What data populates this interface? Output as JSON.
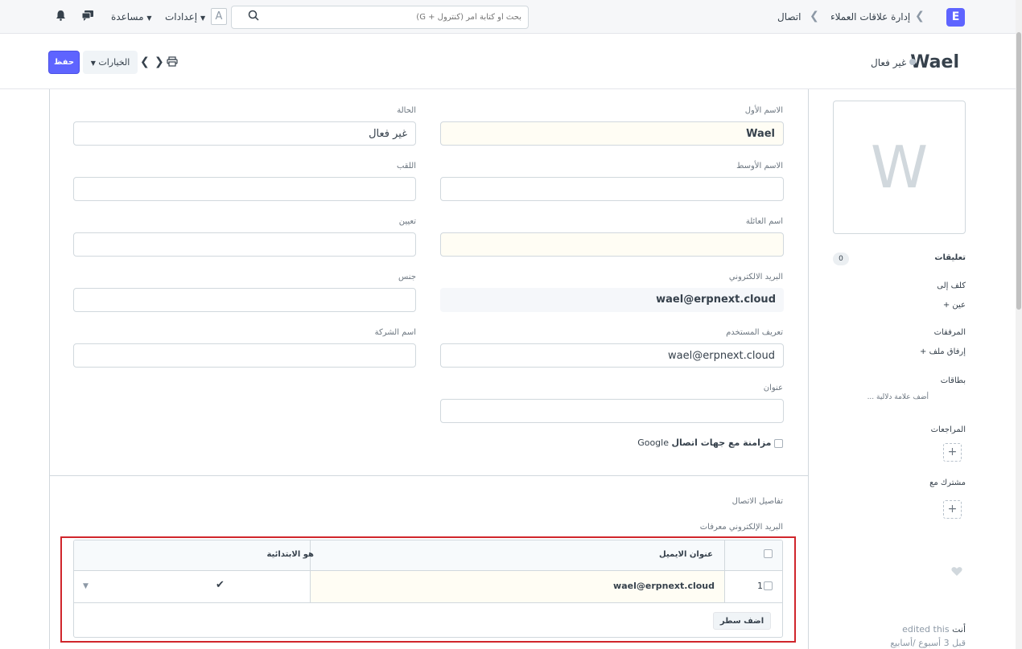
{
  "navbar": {
    "logo": "E",
    "breadcrumbs": [
      "إدارة علاقات العملاء",
      "اتصال"
    ],
    "search_placeholder": "بحث أو كتابة أمر (كنترول + G)",
    "avatar_letter": "A",
    "settings_label": "إعدادات",
    "help_label": "مساعدة",
    "chat_icon": "chat-icon",
    "bell_icon": "bell-icon"
  },
  "header": {
    "title": "Wael",
    "status": "غير فعال",
    "save_label": "حفظ",
    "options_label": "الخيارات"
  },
  "form": {
    "first_name": {
      "label": "الاسم الأول",
      "value": "Wael"
    },
    "status": {
      "label": "الحالة",
      "value": "غير فعال"
    },
    "middle_name": {
      "label": "الاسم الأوسط",
      "value": ""
    },
    "salutation": {
      "label": "اللقب",
      "value": ""
    },
    "last_name": {
      "label": "اسم العائلة",
      "value": ""
    },
    "designation": {
      "label": "تعيين",
      "value": ""
    },
    "email": {
      "label": "البريد الالكتروني",
      "value": "wael@erpnext.cloud"
    },
    "gender": {
      "label": "جنس",
      "value": ""
    },
    "user_id": {
      "label": "تعريف المستخدم",
      "value": "wael@erpnext.cloud"
    },
    "company_name": {
      "label": "اسم الشركة",
      "value": ""
    },
    "address": {
      "label": "عنوان",
      "value": ""
    },
    "google_sync": {
      "label_bold": "مزامنة مع جهات اتصال",
      "label_rest": "Google"
    }
  },
  "contact_details": {
    "section_label": "تفاصيل الاتصال",
    "emails_label": "البريد الإلكتروني معرفات",
    "columns": {
      "email": "عنوان الايميل",
      "is_primary": "هو الابتدائية"
    },
    "rows": [
      {
        "idx": "1",
        "email": "wael@erpnext.cloud",
        "is_primary": "✔"
      }
    ],
    "add_row_label": "اضف سطر"
  },
  "sidebar": {
    "avatar_letter": "W",
    "comments_label": "تعليقات",
    "comments_count": "0",
    "assigned_to_label": "كلف إلى",
    "assign_label": "عين",
    "attachments_label": "المرفقات",
    "attach_label": "إرفاق ملف",
    "tags_label": "بطاقات",
    "add_tag_label": "أضف علامة دلالية ...",
    "reviews_label": "المراجعات",
    "shared_label": "مشترك مع",
    "activity_line1_a": "أنت",
    "activity_line1_b": "edited this",
    "activity_line2": "قبل 3 أسبوع /أسابيع"
  }
}
